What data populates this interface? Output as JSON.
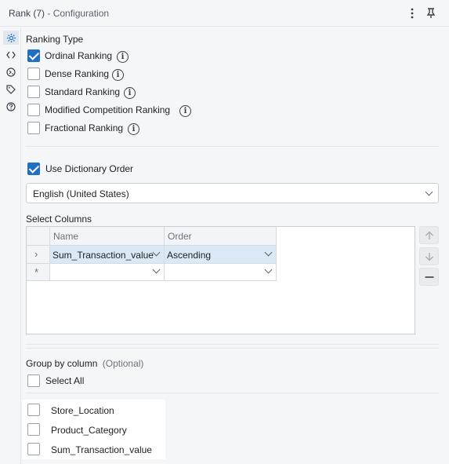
{
  "header": {
    "title": "Rank (7)",
    "subtitle": "- Configuration",
    "more_icon": "more-vertical-icon",
    "pin_icon": "pin-icon"
  },
  "rail": {
    "items": [
      {
        "name": "gear-icon",
        "active": true
      },
      {
        "name": "code-icon",
        "active": false
      },
      {
        "name": "data-icon",
        "active": false
      },
      {
        "name": "tag-icon",
        "active": false
      },
      {
        "name": "help-icon",
        "active": false
      }
    ]
  },
  "ranking": {
    "heading": "Ranking Type",
    "options": [
      {
        "label": "Ordinal Ranking",
        "checked": true
      },
      {
        "label": "Dense Ranking",
        "checked": false
      },
      {
        "label": "Standard Ranking",
        "checked": false
      },
      {
        "label": "Modified Competition Ranking",
        "checked": false
      },
      {
        "label": "Fractional Ranking",
        "checked": false
      }
    ]
  },
  "dictionary": {
    "label": "Use Dictionary Order",
    "checked": true,
    "locale": "English (United States)"
  },
  "columns": {
    "heading": "Select Columns",
    "headers": [
      "Name",
      "Order"
    ],
    "rows": [
      {
        "indicator": "›",
        "name": "Sum_Transaction_value",
        "order": "Ascending"
      },
      {
        "indicator": "*",
        "name": "",
        "order": ""
      }
    ]
  },
  "group_by": {
    "heading": "Group by column",
    "optional": "(Optional)",
    "select_all": "Select All",
    "items": [
      {
        "label": "Store_Location",
        "checked": false
      },
      {
        "label": "Product_Category",
        "checked": false
      },
      {
        "label": "Sum_Transaction_value",
        "checked": false
      }
    ]
  },
  "colors": {
    "accent": "#1f6fc4",
    "selected_row": "#dbe8f6",
    "panel_bg": "#f5f6f8"
  }
}
